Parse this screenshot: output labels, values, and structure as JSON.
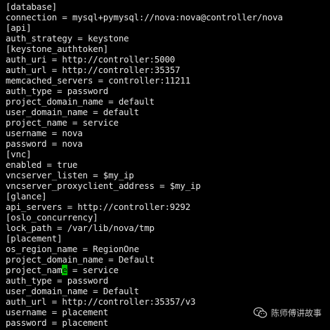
{
  "terminal": {
    "lines": [
      "[database]",
      "connection = mysql+pymysql://nova:nova@controller/nova",
      "[api]",
      "auth_strategy = keystone",
      "[keystone_authtoken]",
      "auth_uri = http://controller:5000",
      "auth_url = http://controller:35357",
      "memcached_servers = controller:11211",
      "auth_type = password",
      "project_domain_name = default",
      "user_domain_name = default",
      "project_name = service",
      "username = nova",
      "password = nova",
      "[vnc]",
      "enabled = true",
      "vncserver_listen = $my_ip",
      "vncserver_proxyclient_address = $my_ip",
      "[glance]",
      "api_servers = http://controller:9292",
      "[oslo_concurrency]",
      "lock_path = /var/lib/nova/tmp",
      "[placement]",
      "os_region_name = RegionOne",
      "project_domain_name = Default",
      {
        "before": "project_nam",
        "cursor": "e",
        "after": " = service"
      },
      "auth_type = password",
      "user_domain_name = Default",
      "auth_url = http://controller:35357/v3",
      "username = placement",
      "password = placement"
    ],
    "text_color": "#e6e6e6",
    "background_color": "#000000",
    "cursor_color": "#00c000"
  },
  "watermark": {
    "text": "陈师傅讲故事",
    "icon": "wechat-icon"
  }
}
